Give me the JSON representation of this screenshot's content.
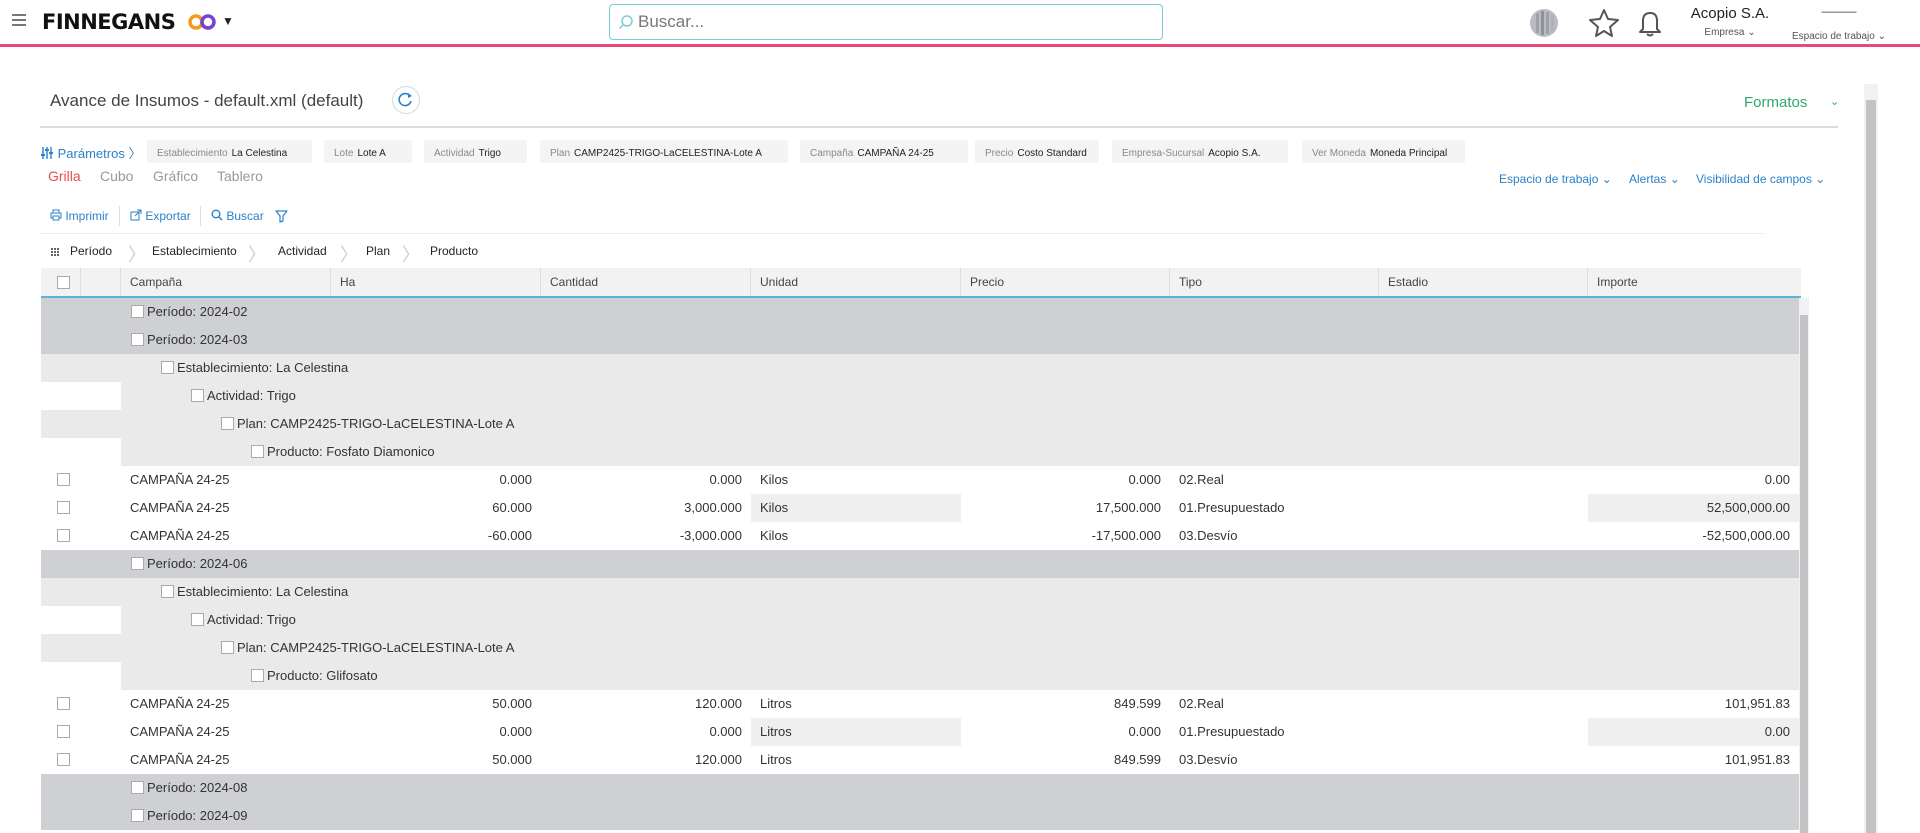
{
  "topbar": {
    "brand": "FINNEGANS",
    "search_placeholder": "Buscar...",
    "company_name": "Acopio S.A.",
    "company_label": "Empresa",
    "workspace_label": "Espacio de trabajo",
    "brand_colors": {
      "accent": "#e8487a",
      "logo_orange": "#f59a1b",
      "logo_purple": "#7b3fd1"
    }
  },
  "page": {
    "title": "Avance de Insumos - default.xml (default)",
    "formatos_label": "Formatos"
  },
  "params": {
    "link_label": "Parámetros",
    "items": [
      {
        "key": "Establecimiento",
        "value": "La Celestina"
      },
      {
        "key": "Lote",
        "value": "Lote A"
      },
      {
        "key": "Actividad",
        "value": "Trigo"
      },
      {
        "key": "Plan",
        "value": "CAMP2425-TRIGO-LaCELESTINA-Lote A"
      },
      {
        "key": "Campaña",
        "value": "CAMPAÑA 24-25"
      },
      {
        "key": "Precio",
        "value": "Costo Standard"
      },
      {
        "key": "Empresa-Sucursal",
        "value": "Acopio S.A."
      },
      {
        "key": "Ver Moneda",
        "value": "Moneda Principal"
      }
    ]
  },
  "views": {
    "tabs": [
      "Grilla",
      "Cubo",
      "Gráfico",
      "Tablero"
    ],
    "active": "Grilla",
    "right_menu": [
      "Espacio de trabajo",
      "Alertas",
      "Visibilidad de campos"
    ]
  },
  "toolbar": {
    "print_label": "Imprimir",
    "export_label": "Exportar",
    "search_label": "Buscar"
  },
  "groupby": [
    "Período",
    "Establecimiento",
    "Actividad",
    "Plan",
    "Producto"
  ],
  "grid": {
    "columns": [
      "Campaña",
      "Ha",
      "Cantidad",
      "Unidad",
      "Precio",
      "Tipo",
      "Estadio",
      "Importe"
    ],
    "rows": [
      {
        "type": "group",
        "level": 0,
        "label": "Período: 2024-02"
      },
      {
        "type": "group",
        "level": 0,
        "label": "Período: 2024-03"
      },
      {
        "type": "group",
        "level": 1,
        "label": "Establecimiento: La Celestina"
      },
      {
        "type": "group",
        "level": 2,
        "label": "Actividad: Trigo"
      },
      {
        "type": "group",
        "level": 3,
        "label": "Plan: CAMP2425-TRIGO-LaCELESTINA-Lote A"
      },
      {
        "type": "group",
        "level": 4,
        "label": "Producto: Fosfato Diamonico"
      },
      {
        "type": "data",
        "cells": [
          "CAMPAÑA 24-25",
          "0.000",
          "0.000",
          "Kilos",
          "0.000",
          "02.Real",
          "",
          "0.00"
        ]
      },
      {
        "type": "data",
        "cells": [
          "CAMPAÑA 24-25",
          "60.000",
          "3,000.000",
          "Kilos",
          "17,500.000",
          "01.Presupuestado",
          "",
          "52,500,000.00"
        ]
      },
      {
        "type": "data",
        "cells": [
          "CAMPAÑA 24-25",
          "-60.000",
          "-3,000.000",
          "Kilos",
          "-17,500.000",
          "03.Desvío",
          "",
          "-52,500,000.00"
        ]
      },
      {
        "type": "group",
        "level": 0,
        "label": "Período: 2024-06"
      },
      {
        "type": "group",
        "level": 1,
        "label": "Establecimiento: La Celestina"
      },
      {
        "type": "group",
        "level": 2,
        "label": "Actividad: Trigo"
      },
      {
        "type": "group",
        "level": 3,
        "label": "Plan: CAMP2425-TRIGO-LaCELESTINA-Lote A"
      },
      {
        "type": "group",
        "level": 4,
        "label": "Producto: Glifosato"
      },
      {
        "type": "data",
        "cells": [
          "CAMPAÑA 24-25",
          "50.000",
          "120.000",
          "Litros",
          "849.599",
          "02.Real",
          "",
          "101,951.83"
        ]
      },
      {
        "type": "data",
        "cells": [
          "CAMPAÑA 24-25",
          "0.000",
          "0.000",
          "Litros",
          "0.000",
          "01.Presupuestado",
          "",
          "0.00"
        ]
      },
      {
        "type": "data",
        "cells": [
          "CAMPAÑA 24-25",
          "50.000",
          "120.000",
          "Litros",
          "849.599",
          "03.Desvío",
          "",
          "101,951.83"
        ]
      },
      {
        "type": "group",
        "level": 0,
        "label": "Período: 2024-08"
      },
      {
        "type": "group",
        "level": 0,
        "label": "Período: 2024-09"
      }
    ]
  }
}
